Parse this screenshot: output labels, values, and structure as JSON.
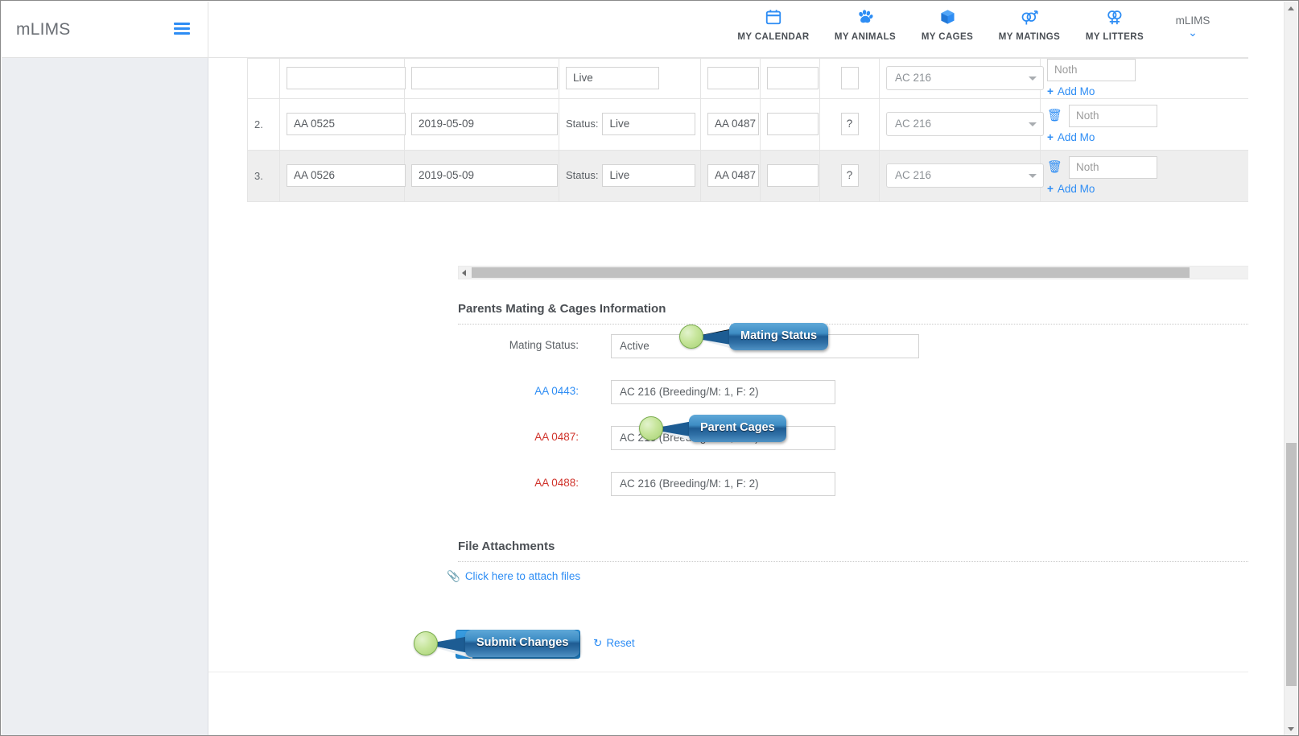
{
  "app": {
    "brand": "mLIMS",
    "menu_icon": "hamburger-icon",
    "user_label": "mLIMS"
  },
  "nav": {
    "items": [
      {
        "label": "MY CALENDAR",
        "icon": "calendar-icon"
      },
      {
        "label": "MY ANIMALS",
        "icon": "paw-icon"
      },
      {
        "label": "MY CAGES",
        "icon": "cube-icon"
      },
      {
        "label": "MY MATINGS",
        "icon": "mating-symbol-icon"
      },
      {
        "label": "MY LITTERS",
        "icon": "litter-symbol-icon"
      }
    ]
  },
  "table": {
    "status_label": "Status:",
    "add_more_label": "Add Mo",
    "add_more_plus": "+",
    "delete_icon": "trash-icon",
    "nothing_placeholder": "Noth",
    "clipped_row": {
      "status_value": "Live",
      "cage": "AC 216"
    },
    "rows": [
      {
        "index": "2.",
        "animal_id": "AA 0525",
        "date": "2019-05-09",
        "status": "Live",
        "sire": "AA 0487",
        "dam": "",
        "sex": "?",
        "cage": "AC 216",
        "nothing": "Noth"
      },
      {
        "index": "3.",
        "animal_id": "AA 0526",
        "date": "2019-05-09",
        "status": "Live",
        "sire": "AA 0487",
        "dam": "",
        "sex": "?",
        "cage": "AC 216",
        "nothing": "Noth"
      }
    ]
  },
  "parents_section": {
    "title": "Parents Mating & Cages Information",
    "mating_status_label": "Mating Status:",
    "mating_status_value": "Active",
    "cages": [
      {
        "label": "AA 0443:",
        "value": "AC 216 (Breeding/M: 1, F: 2)",
        "sex": "male"
      },
      {
        "label": "AA 0487:",
        "value": "AC 216 (Breeding/M: 1, F: 2)",
        "sex": "female"
      },
      {
        "label": "AA 0488:",
        "value": "AC 216 (Breeding/M: 1, F: 2)",
        "sex": "female"
      }
    ]
  },
  "attachments_section": {
    "title": "File Attachments",
    "link_label": "Click here to attach files",
    "link_icon": "paperclip-icon"
  },
  "actions": {
    "submit_label": "Submit",
    "reset_label": "Reset",
    "reset_icon": "refresh-icon"
  },
  "callouts": [
    {
      "text": "Mating Status",
      "marker": "green-circle-marker"
    },
    {
      "text": "Parent Cages",
      "marker": "green-circle-marker"
    },
    {
      "text": "Submit Changes",
      "marker": "green-circle-marker"
    }
  ],
  "colors": {
    "accent_blue": "#2e8df4",
    "male_blue": "#2e8df4",
    "female_red": "#d0342c",
    "submit_blue": "#1f86cf",
    "callout_blue": "#1e5b92",
    "marker_green": "#a7d175",
    "sidebar_bg": "#eceef2"
  },
  "scrollbars": {
    "horizontal": "table-horizontal-scrollbar",
    "vertical": "page-vertical-scrollbar"
  }
}
